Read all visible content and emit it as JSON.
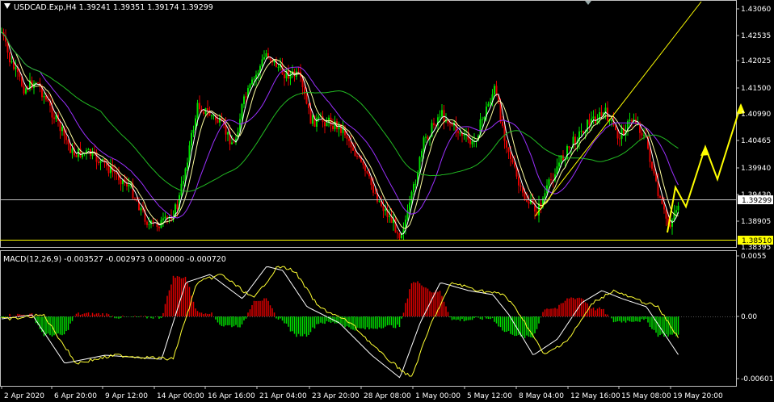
{
  "main_header": "USDCAD.Exp,H4  1.39241 1.39351 1.39174 1.39299",
  "macd_header": "MACD(12,26,9) -0.003527 -0.002973 0.000000 -0.000720",
  "price_axis": [
    "1.43060",
    "1.42535",
    "1.42025",
    "1.41500",
    "1.40990",
    "1.40465",
    "1.39940",
    "1.39430",
    "1.38905",
    "1.38395"
  ],
  "current_price_label": "1.39299",
  "support_price_label": "1.38510",
  "macd_axis": [
    "0.0055",
    "0.00",
    "-0.006015"
  ],
  "time_axis": [
    "2 Apr 2020",
    "6 Apr 20:00",
    "9 Apr 12:00",
    "14 Apr 00:00",
    "16 Apr 16:00",
    "21 Apr 04:00",
    "23 Apr 20:00",
    "28 Apr 08:00",
    "1 May 00:00",
    "5 May 12:00",
    "8 May 04:00",
    "12 May 16:00",
    "15 May 08:00",
    "19 May 20:00"
  ],
  "colors": {
    "background": "#000000",
    "grid": "#c0c0c0",
    "bull_candle": "#00e000",
    "bear_candle": "#e00000",
    "ma_fast": "#ffffff",
    "ma_mid": "#ffffa0",
    "ma_slow_purple": "#9b30ff",
    "ma_slowest_green": "#22bb22",
    "macd_signal": "#ffff33",
    "forecast_arrow": "#ffff00",
    "support_line": "#ffff00"
  },
  "icons": [
    "down-triangle-icon"
  ]
}
